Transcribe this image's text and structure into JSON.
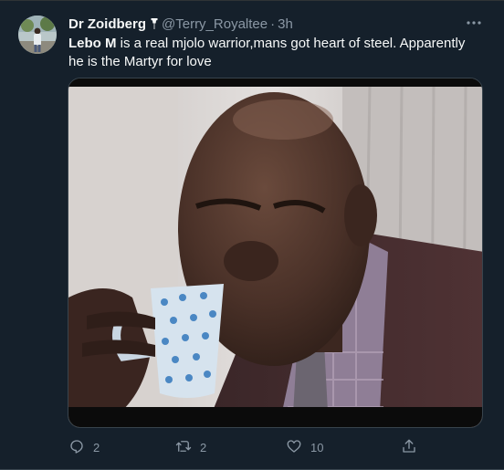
{
  "tweet": {
    "author": {
      "display_name": "Dr Zoidberg",
      "handle": "@Terry_Royaltee",
      "separator": "·",
      "time": "3h"
    },
    "text": "Lebo M is a real mjolo warrior,mans got heart of steel. Apparently he is the Martyr for love",
    "text_bold_part": "Lebo M",
    "text_rest": " is a real mjolo warrior,mans got heart of steel. Apparently he is the Martyr for love",
    "actions": {
      "reply_count": "2",
      "retweet_count": "2",
      "like_count": "10"
    }
  },
  "icons": {
    "more": "more-horizontal-icon",
    "reply": "reply-icon",
    "retweet": "retweet-icon",
    "like": "heart-icon",
    "share": "share-icon",
    "pin": "pin-icon"
  },
  "colors": {
    "background": "#15202b",
    "primary_text": "#f7f9f9",
    "secondary_text": "#8b98a5",
    "border": "#38444d"
  }
}
